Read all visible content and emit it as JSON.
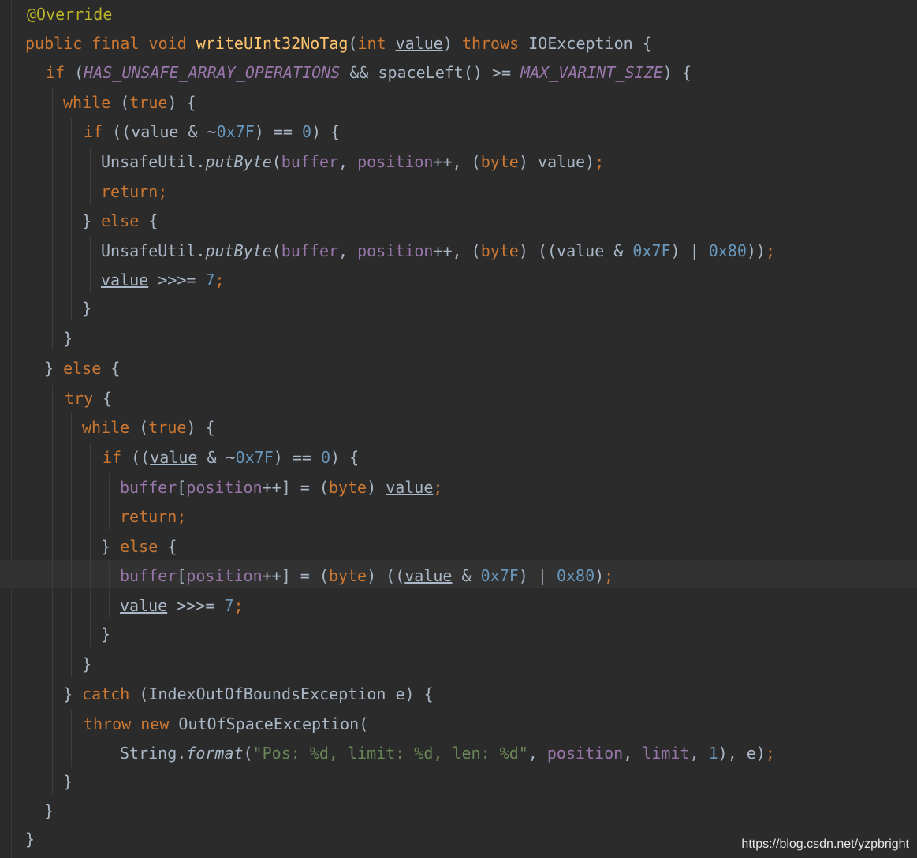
{
  "editor": {
    "language": "java",
    "lines": [
      "@Override",
      "public final void writeUInt32NoTag(int value) throws IOException {",
      "if (HAS_UNSAFE_ARRAY_OPERATIONS && spaceLeft() >= MAX_VARINT_SIZE) {",
      "while (true) {",
      "if ((value & ~0x7F) == 0) {",
      "UnsafeUtil.putByte(buffer, position++, (byte) value);",
      "return;",
      "} else {",
      "UnsafeUtil.putByte(buffer, position++, (byte) ((value & 0x7F) | 0x80));",
      "value >>>= 7;",
      "}",
      "}",
      "} else {",
      "try {",
      "while (true) {",
      "if ((value & ~0x7F) == 0) {",
      "buffer[position++] = (byte) value;",
      "return;",
      "} else {",
      "buffer[position++] = (byte) ((value & 0x7F) | 0x80);",
      "value >>>= 7;",
      "}",
      "}",
      "} catch (IndexOutOfBoundsException e) {",
      "throw new OutOfSpaceException(",
      "String.format(\"Pos: %d, limit: %d, len: %d\", position, limit, 1), e);",
      "}",
      "}",
      "}"
    ]
  },
  "watermark": "https://blog.csdn.net/yzpbright",
  "colors": {
    "background": "#2b2b2b",
    "keyword": "#cc7832",
    "method": "#ffc66d",
    "annotation": "#bbb529",
    "number": "#6897bb",
    "field": "#9876aa",
    "string": "#6a8759",
    "text": "#a9b7c6"
  }
}
